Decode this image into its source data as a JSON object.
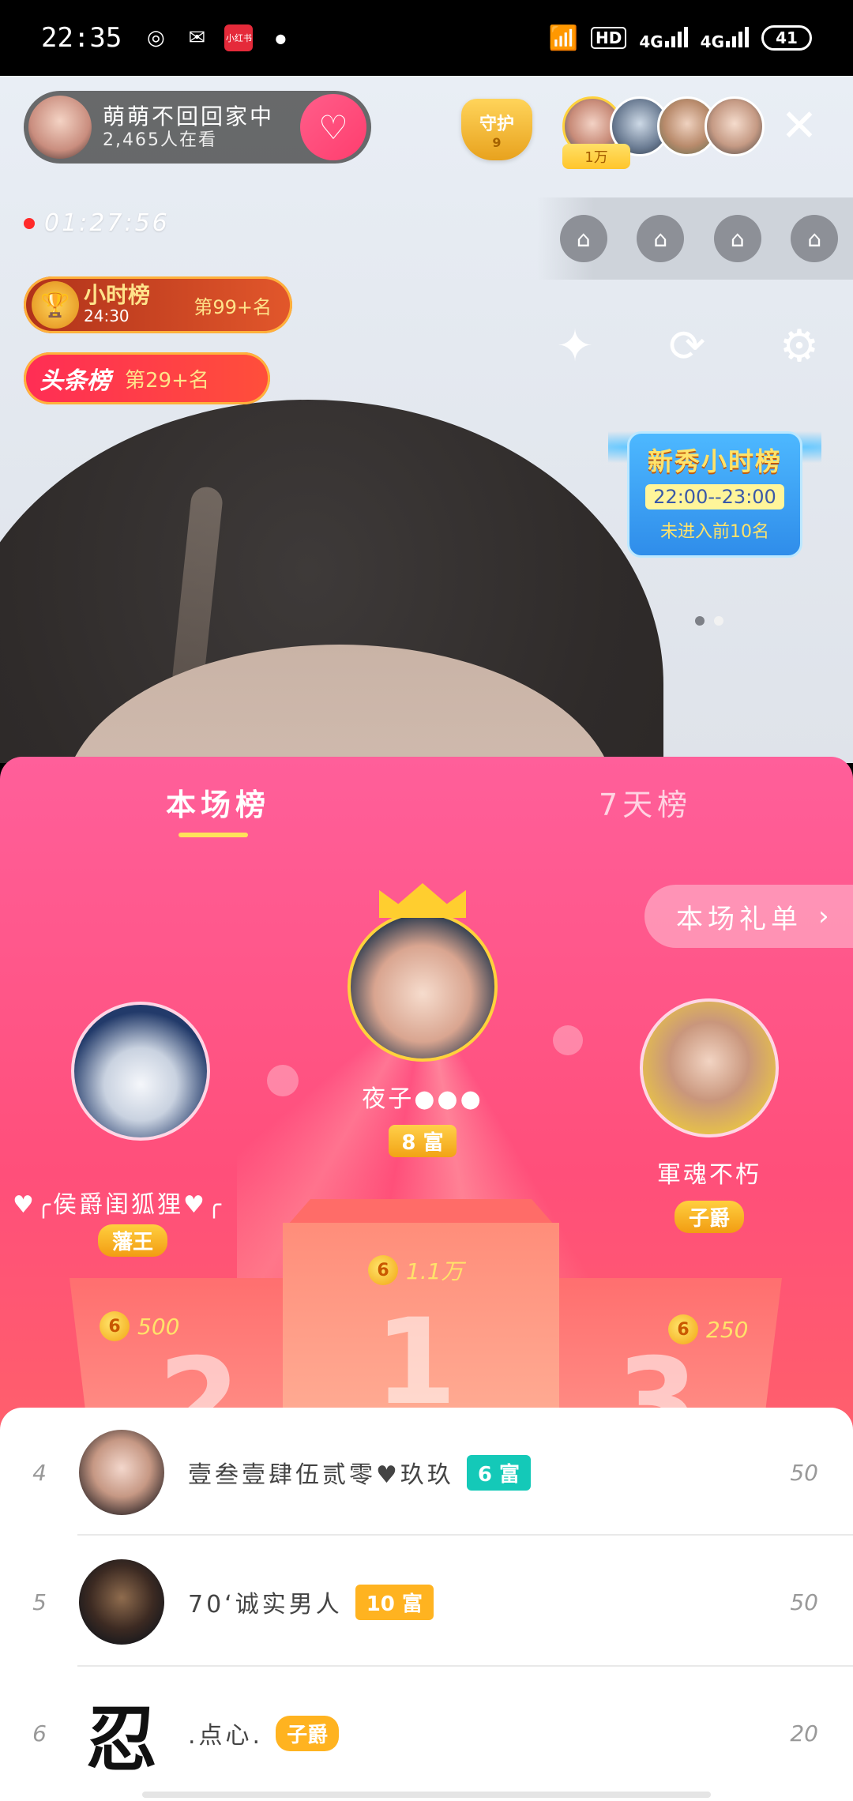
{
  "status_bar": {
    "time": "22:35",
    "app_icons": [
      "weibo-icon",
      "wechat-icon",
      "xiaohongshu-icon",
      "dot-icon"
    ],
    "xiaohongshu_label": "小红书",
    "hd_label": "HD",
    "network_1": "4G",
    "network_2": "4G",
    "battery": "41"
  },
  "live": {
    "host_name": "萌萌不回回家中",
    "viewers": "2,465人在看",
    "guard_label": "守护",
    "guard_count": "9",
    "top_viewer_tag": "1万",
    "timer": "01:27:56",
    "hour_rank_title": "小时榜",
    "hour_rank_time": "24:30",
    "hour_rank_pos": "第99+名",
    "headline_rank_title": "头条榜",
    "headline_rank_pos": "第29+名",
    "newbie_title": "新秀小时榜",
    "newbie_time": "22:00--23:00",
    "newbie_status": "未进入前10名"
  },
  "panel": {
    "tab_current": "本场榜",
    "tab_7days": "7天榜",
    "gift_list_label": "本场礼单",
    "first": {
      "name": "夜子●●●",
      "badge": "8 富",
      "coins": "1.1万"
    },
    "second": {
      "name": "♥╭侯爵闺狐狸♥╭",
      "badge": "藩王",
      "coins": "500"
    },
    "third": {
      "name": "軍魂不朽",
      "badge": "子爵",
      "coins": "250"
    },
    "coin_symbol": "6",
    "podium": [
      "1",
      "2",
      "3"
    ]
  },
  "list": [
    {
      "rank": "4",
      "name": "壹叁壹肆伍贰零♥玖玖",
      "tag": "6 富",
      "score": "50"
    },
    {
      "rank": "5",
      "name": "70‘诚实男人",
      "tag": "10 富",
      "score": "50"
    },
    {
      "rank": "6",
      "name": ".点心.",
      "tag": "子爵",
      "score": "20",
      "avatar_glyph": "忍"
    }
  ],
  "colors": {
    "panel_top": "#ff5f9a",
    "panel_bottom": "#ff6f6f",
    "accent_yellow": "#ffe25a",
    "teal_tag": "#14c9b8",
    "gold_tag": "#ffb320"
  }
}
